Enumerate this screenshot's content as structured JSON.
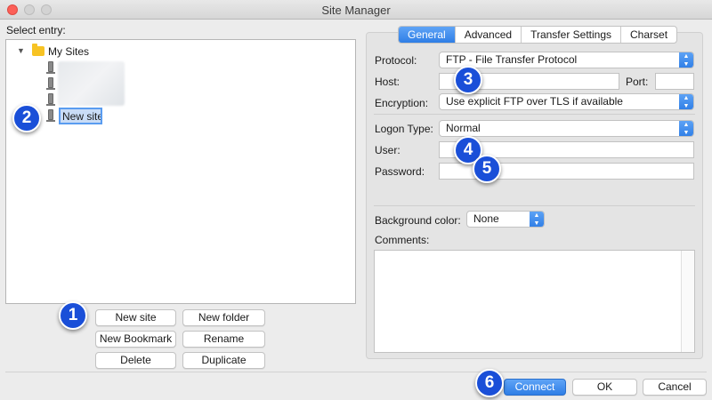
{
  "window": {
    "title": "Site Manager"
  },
  "left": {
    "select_entry_label": "Select entry:",
    "tree": {
      "folder_label": "My Sites",
      "new_site_label": "New site"
    },
    "buttons": {
      "new_site": "New site",
      "new_folder": "New folder",
      "new_bookmark": "New Bookmark",
      "rename": "Rename",
      "delete": "Delete",
      "duplicate": "Duplicate"
    }
  },
  "tabs": [
    "General",
    "Advanced",
    "Transfer Settings",
    "Charset"
  ],
  "general": {
    "protocol_label": "Protocol:",
    "protocol_value": "FTP - File Transfer Protocol",
    "host_label": "Host:",
    "host_value": "",
    "port_label": "Port:",
    "port_value": "",
    "encryption_label": "Encryption:",
    "encryption_value": "Use explicit FTP over TLS if available",
    "logon_type_label": "Logon Type:",
    "logon_type_value": "Normal",
    "user_label": "User:",
    "user_value": "",
    "password_label": "Password:",
    "password_value": "",
    "background_color_label": "Background color:",
    "background_color_value": "None",
    "comments_label": "Comments:",
    "comments_value": ""
  },
  "footer": {
    "connect": "Connect",
    "ok": "OK",
    "cancel": "Cancel"
  },
  "callouts": [
    "1",
    "2",
    "3",
    "4",
    "5",
    "6"
  ],
  "colors": {
    "accent": "#2f7ee6",
    "callout": "#1a4fd8",
    "folder": "#f7c324",
    "close_button": "#fc5f57"
  }
}
